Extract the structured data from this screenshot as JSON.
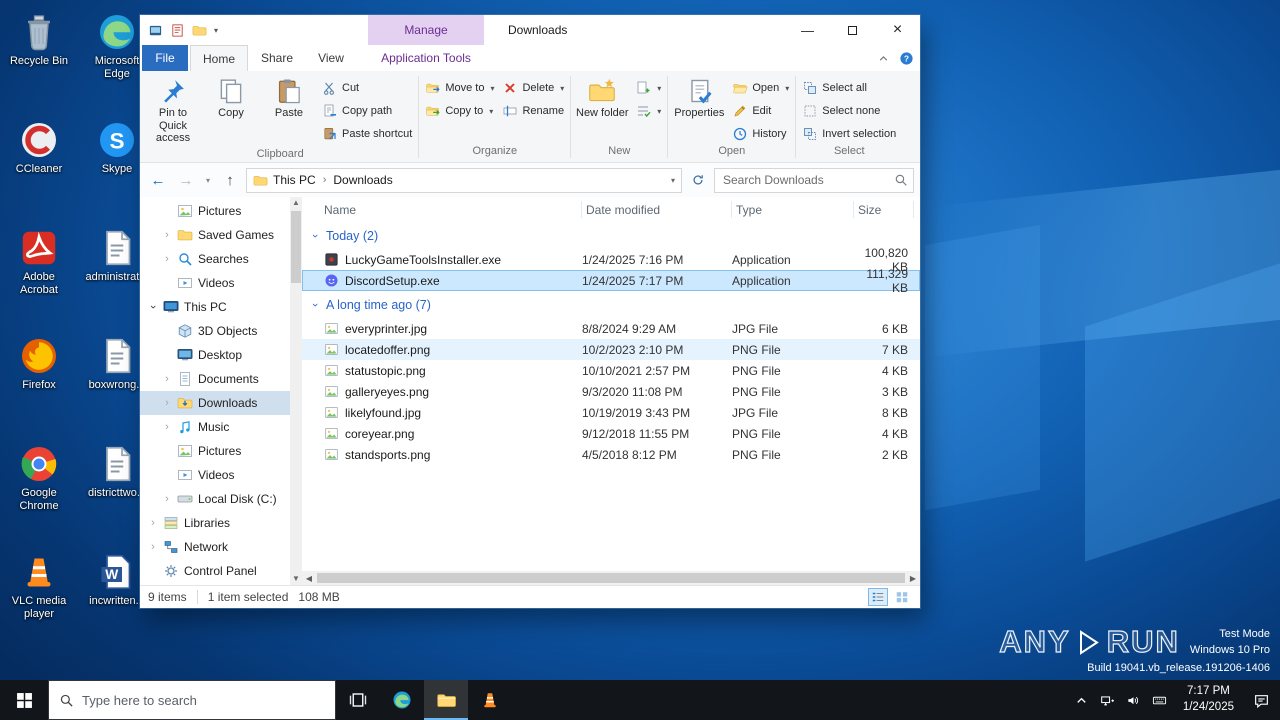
{
  "window": {
    "title": "Downloads",
    "manage_label": "Manage",
    "application_tools_label": "Application Tools",
    "tabs": {
      "file": "File",
      "home": "Home",
      "share": "Share",
      "view": "View"
    }
  },
  "ribbon": {
    "clipboard": {
      "label": "Clipboard",
      "pin": "Pin to Quick access",
      "copy": "Copy",
      "paste": "Paste",
      "cut": "Cut",
      "copy_path": "Copy path",
      "paste_shortcut": "Paste shortcut"
    },
    "organize": {
      "label": "Organize",
      "move_to": "Move to",
      "copy_to": "Copy to",
      "delete": "Delete",
      "rename": "Rename"
    },
    "new": {
      "label": "New",
      "new_folder": "New folder"
    },
    "open": {
      "label": "Open",
      "properties": "Properties",
      "open": "Open",
      "edit": "Edit",
      "history": "History"
    },
    "select": {
      "label": "Select",
      "select_all": "Select all",
      "select_none": "Select none",
      "invert": "Invert selection"
    }
  },
  "addressbar": {
    "breadcrumb_root": "This PC",
    "breadcrumb_current": "Downloads",
    "search_placeholder": "Search Downloads"
  },
  "navpane": {
    "items": [
      {
        "label": "Pictures",
        "icon": "pictures",
        "indent": 1,
        "chevron": null,
        "selected": false
      },
      {
        "label": "Saved Games",
        "icon": "saved-games",
        "indent": 1,
        "chevron": "right",
        "selected": false
      },
      {
        "label": "Searches",
        "icon": "searches",
        "indent": 1,
        "chevron": "right",
        "selected": false
      },
      {
        "label": "Videos",
        "icon": "videos",
        "indent": 1,
        "chevron": null,
        "selected": false
      },
      {
        "label": "This PC",
        "icon": "this-pc",
        "indent": 0,
        "chevron": "down",
        "selected": false
      },
      {
        "label": "3D Objects",
        "icon": "3d-objects",
        "indent": 1,
        "chevron": null,
        "selected": false
      },
      {
        "label": "Desktop",
        "icon": "desktop",
        "indent": 1,
        "chevron": null,
        "selected": false
      },
      {
        "label": "Documents",
        "icon": "documents",
        "indent": 1,
        "chevron": "right",
        "selected": false
      },
      {
        "label": "Downloads",
        "icon": "downloads",
        "indent": 1,
        "chevron": "right",
        "selected": true
      },
      {
        "label": "Music",
        "icon": "music",
        "indent": 1,
        "chevron": "right",
        "selected": false
      },
      {
        "label": "Pictures",
        "icon": "pictures",
        "indent": 1,
        "chevron": null,
        "selected": false
      },
      {
        "label": "Videos",
        "icon": "videos",
        "indent": 1,
        "chevron": null,
        "selected": false
      },
      {
        "label": "Local Disk (C:)",
        "icon": "disk",
        "indent": 1,
        "chevron": "right",
        "selected": false
      },
      {
        "label": "Libraries",
        "icon": "libraries",
        "indent": 0,
        "chevron": "right",
        "selected": false
      },
      {
        "label": "Network",
        "icon": "network",
        "indent": 0,
        "chevron": "right",
        "selected": false
      },
      {
        "label": "Control Panel",
        "icon": "control-panel",
        "indent": 0,
        "chevron": null,
        "selected": false
      }
    ]
  },
  "filelist": {
    "columns": {
      "name": "Name",
      "date": "Date modified",
      "type": "Type",
      "size": "Size"
    },
    "groups": [
      {
        "label": "Today (2)",
        "files": [
          {
            "name": "LuckyGameToolsInstaller.exe",
            "date": "1/24/2025 7:16 PM",
            "type": "Application",
            "size": "100,820 KB",
            "icon": "exe-dark",
            "state": null
          },
          {
            "name": "DiscordSetup.exe",
            "date": "1/24/2025 7:17 PM",
            "type": "Application",
            "size": "111,329 KB",
            "icon": "exe-discord",
            "state": "selected"
          }
        ]
      },
      {
        "label": "A long time ago (7)",
        "files": [
          {
            "name": "everyprinter.jpg",
            "date": "8/8/2024 9:29 AM",
            "type": "JPG File",
            "size": "6 KB",
            "icon": "image",
            "state": null
          },
          {
            "name": "locatedoffer.png",
            "date": "10/2/2023 2:10 PM",
            "type": "PNG File",
            "size": "7 KB",
            "icon": "image",
            "state": "hover"
          },
          {
            "name": "statustopic.png",
            "date": "10/10/2021 2:57 PM",
            "type": "PNG File",
            "size": "4 KB",
            "icon": "image",
            "state": null
          },
          {
            "name": "galleryeyes.png",
            "date": "9/3/2020 11:08 PM",
            "type": "PNG File",
            "size": "3 KB",
            "icon": "image",
            "state": null
          },
          {
            "name": "likelyfound.jpg",
            "date": "10/19/2019 3:43 PM",
            "type": "JPG File",
            "size": "8 KB",
            "icon": "image",
            "state": null
          },
          {
            "name": "coreyear.png",
            "date": "9/12/2018 11:55 PM",
            "type": "PNG File",
            "size": "4 KB",
            "icon": "image",
            "state": null
          },
          {
            "name": "standsports.png",
            "date": "4/5/2018 8:12 PM",
            "type": "PNG File",
            "size": "2 KB",
            "icon": "image",
            "state": null
          }
        ]
      }
    ]
  },
  "statusbar": {
    "items_count": "9 items",
    "selection_count": "1 item selected",
    "selection_size": "108 MB"
  },
  "desktop": {
    "columns": [
      [
        {
          "label": "Recycle Bin",
          "icon": "recycle-bin"
        },
        {
          "label": "CCleaner",
          "icon": "ccleaner"
        },
        {
          "label": "Adobe Acrobat",
          "icon": "acrobat"
        },
        {
          "label": "Firefox",
          "icon": "firefox"
        },
        {
          "label": "Google Chrome",
          "icon": "chrome"
        },
        {
          "label": "VLC media player",
          "icon": "vlc"
        }
      ],
      [
        {
          "label": "Microsoft Edge",
          "icon": "edge"
        },
        {
          "label": "Skype",
          "icon": "skype"
        },
        {
          "label": "administrat...",
          "icon": "text-doc"
        },
        {
          "label": "boxwrong...",
          "icon": "text-doc"
        },
        {
          "label": "districttwo...",
          "icon": "text-doc"
        },
        {
          "label": "incwritten...",
          "icon": "word-doc"
        }
      ]
    ]
  },
  "taskbar": {
    "search_placeholder": "Type here to search",
    "apps": [
      {
        "name": "task-view",
        "icon": "task-view",
        "active": false
      },
      {
        "name": "edge",
        "icon": "edge",
        "active": false
      },
      {
        "name": "file-explorer",
        "icon": "explorer-folder",
        "active": true
      },
      {
        "name": "vlc",
        "icon": "vlc",
        "active": false
      }
    ],
    "tray": [
      "tray-chevron",
      "network-tray",
      "speaker",
      "keyboard"
    ],
    "clock_time": "7:17 PM",
    "clock_date": "1/24/2025"
  },
  "watermark": {
    "brand_left": "ANY",
    "brand_right": "RUN",
    "mode": "Test Mode",
    "os_name": "Windows 10 Pro",
    "build": "Build 19041.vb_release.191206-1406"
  }
}
